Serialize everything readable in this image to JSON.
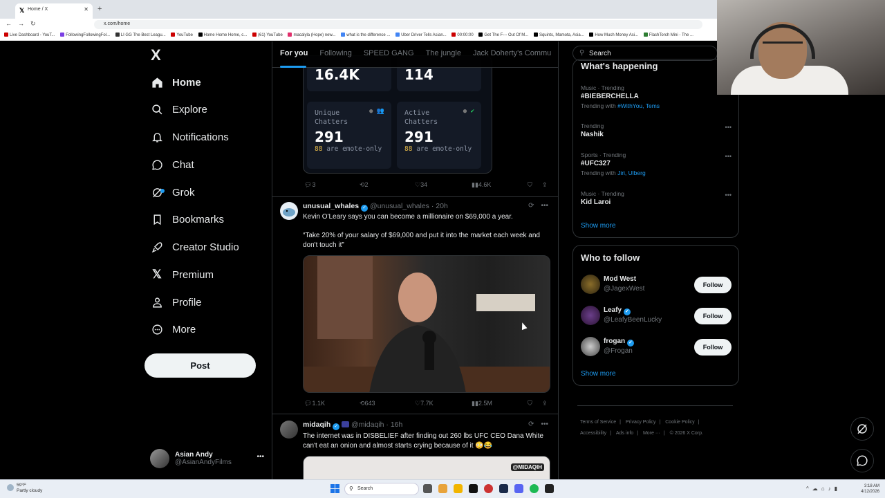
{
  "browser": {
    "tab_title": "Home / X",
    "url": "x.com/home",
    "bookmarks": [
      "Live Dashboard - YouT...",
      "FollowingFollowingFol...",
      "LI GG The Best Leagu...",
      "YouTube",
      "Home Home Home, c...",
      "(61) YouTube",
      "macalyla (Hope) new...",
      "what is the difference ...",
      "Uber Driver Tells Asian...",
      "00:00:00",
      "Get The F--- Out Of M...",
      "Squints, Mamota, Asia...",
      "How Much Money Asi...",
      "FlashTorch Mini - The ..."
    ]
  },
  "nav": {
    "logo": "X",
    "items": [
      {
        "label": "Home",
        "icon": "home-icon"
      },
      {
        "label": "Explore",
        "icon": "search-icon"
      },
      {
        "label": "Notifications",
        "icon": "bell-icon"
      },
      {
        "label": "Chat",
        "icon": "chat-icon"
      },
      {
        "label": "Grok",
        "icon": "grok-icon"
      },
      {
        "label": "Bookmarks",
        "icon": "bookmark-icon"
      },
      {
        "label": "Creator Studio",
        "icon": "rocket-icon"
      },
      {
        "label": "Premium",
        "icon": "x-premium-icon"
      },
      {
        "label": "Profile",
        "icon": "person-icon"
      },
      {
        "label": "More",
        "icon": "more-circle-icon"
      }
    ],
    "post_label": "Post",
    "account": {
      "name": "Asian Andy",
      "handle": "@AsianAndyFilms"
    }
  },
  "feed": {
    "tabs": [
      "For you",
      "Following",
      "SPEED GANG",
      "The jungle",
      "Jack Doherty's Commu"
    ],
    "stats_card": {
      "top_left_value": "16.4K",
      "top_right_value": "114",
      "unique_label": "Unique Chatters",
      "unique_value": "291",
      "unique_emote_count": "88",
      "active_label": "Active Chatters",
      "active_value": "291",
      "active_emote_count": "88",
      "emote_text": "are emote-only"
    },
    "tweet0_actions": {
      "replies": "3",
      "reposts": "2",
      "likes": "34",
      "views": "4.6K"
    },
    "tweet1": {
      "name": "unusual_whales",
      "handle": "@unusual_whales",
      "time": "20h",
      "text1": "Kevin O'Leary says you can become a millionaire on $69,000 a year.",
      "text2": "“Take 20% of your salary of $69,000 and put it into the market each week and don't touch it”",
      "replies": "1.1K",
      "reposts": "643",
      "likes": "7.7K",
      "views": "2.5M"
    },
    "tweet2": {
      "name": "midaqih",
      "handle": "@midaqih",
      "time": "16h",
      "text": "The internet was in DISBELIEF after finding out 260 lbs UFC CEO Dana White can't eat an onion and almost starts crying because of it 😳😂",
      "watermark": "@MIDAQIH"
    }
  },
  "right": {
    "search_placeholder": "Search",
    "happening_title": "What's happening",
    "trends": [
      {
        "cat": "Music · Trending",
        "name": "#BIEBERCHELLA",
        "with_prefix": "Trending with ",
        "with_links": "#WithYou, Tems"
      },
      {
        "cat": "Trending",
        "name": "Nashik",
        "with_prefix": "",
        "with_links": ""
      },
      {
        "cat": "Sports · Trending",
        "name": "#UFC327",
        "with_prefix": "Trending with ",
        "with_links": "Jiri, Ulberg"
      },
      {
        "cat": "Music · Trending",
        "name": "Kid Laroi",
        "with_prefix": "",
        "with_links": ""
      }
    ],
    "show_more": "Show more",
    "wtf_title": "Who to follow",
    "follow_label": "Follow",
    "suggestions": [
      {
        "name": "Mod West",
        "handle": "@JagexWest",
        "verified": false
      },
      {
        "name": "Leafy",
        "handle": "@LeafyBeenLucky",
        "verified": true
      },
      {
        "name": "frogan",
        "handle": "@Frogan",
        "verified": true
      }
    ],
    "footer": [
      "Terms of Service",
      "Privacy Policy",
      "Cookie Policy",
      "Accessibility",
      "Ads info",
      "More ···",
      "© 2026 X Corp."
    ]
  },
  "taskbar": {
    "weather_temp": "59°F",
    "weather_desc": "Partly cloudy",
    "search_label": "Search",
    "time": "3:18 AM",
    "date": "4/12/2026"
  },
  "colors": {
    "accent": "#1d9bf0",
    "background": "#000000",
    "border": "#2f3336",
    "muted": "#71767b"
  }
}
